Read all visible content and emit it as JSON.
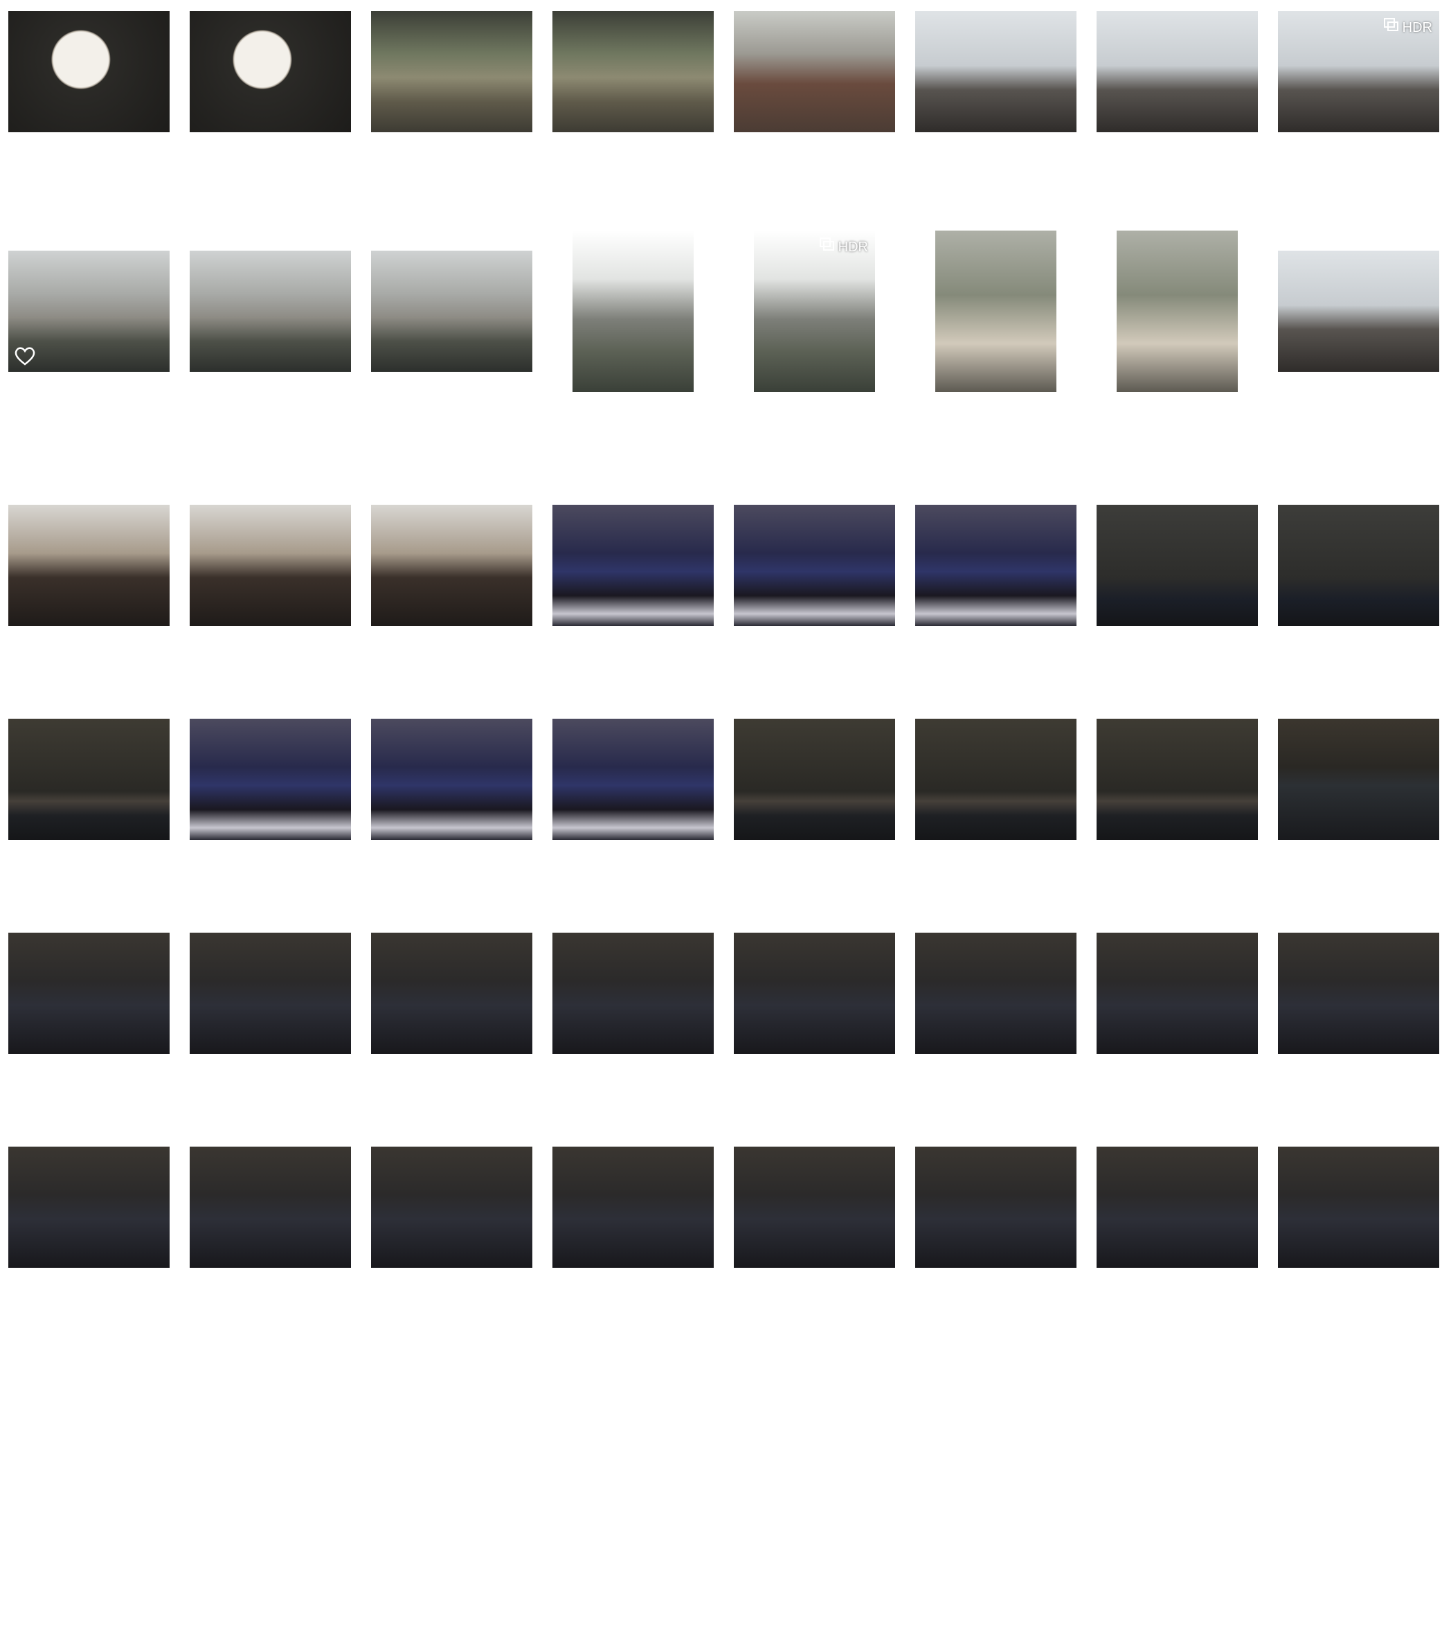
{
  "badge_labels": {
    "hdr": "HDR"
  },
  "icons": {
    "hdr": "hdr-icon",
    "favorite": "heart-icon"
  },
  "rows": [
    [
      {
        "scene": "food"
      },
      {
        "scene": "food"
      },
      {
        "scene": "shop"
      },
      {
        "scene": "shop"
      },
      {
        "scene": "street"
      },
      {
        "scene": "sky"
      },
      {
        "scene": "sky"
      },
      {
        "scene": "sky",
        "hdr": true
      }
    ],
    [
      {
        "scene": "canal",
        "favorite": true
      },
      {
        "scene": "canal"
      },
      {
        "scene": "canal"
      },
      {
        "scene": "canal2",
        "portrait": true
      },
      {
        "scene": "canal2",
        "portrait": true,
        "hdr": true
      },
      {
        "scene": "portrait",
        "portrait": true
      },
      {
        "scene": "portrait",
        "portrait": true
      },
      {
        "scene": "sky"
      }
    ],
    [
      {
        "scene": "selfie"
      },
      {
        "scene": "selfie"
      },
      {
        "scene": "selfie"
      },
      {
        "scene": "nightselfie"
      },
      {
        "scene": "nightselfie"
      },
      {
        "scene": "nightselfie"
      },
      {
        "scene": "nightsky"
      },
      {
        "scene": "nightsky"
      }
    ],
    [
      {
        "scene": "nightcity"
      },
      {
        "scene": "nightselfie"
      },
      {
        "scene": "nightselfie"
      },
      {
        "scene": "nightselfie"
      },
      {
        "scene": "nightcity"
      },
      {
        "scene": "nightcity"
      },
      {
        "scene": "nightcity"
      },
      {
        "scene": "nightgirl"
      }
    ],
    [
      {
        "scene": "railgirl"
      },
      {
        "scene": "railgirl"
      },
      {
        "scene": "railgirl"
      },
      {
        "scene": "railgirl"
      },
      {
        "scene": "railgirl"
      },
      {
        "scene": "railgirl"
      },
      {
        "scene": "railgirl"
      },
      {
        "scene": "railgirl"
      }
    ],
    [
      {
        "scene": "railgirl"
      },
      {
        "scene": "railgirl"
      },
      {
        "scene": "railgirl"
      },
      {
        "scene": "railgirl"
      },
      {
        "scene": "railgirl"
      },
      {
        "scene": "railgirl"
      },
      {
        "scene": "railgirl"
      },
      {
        "scene": "railgirl"
      }
    ]
  ]
}
